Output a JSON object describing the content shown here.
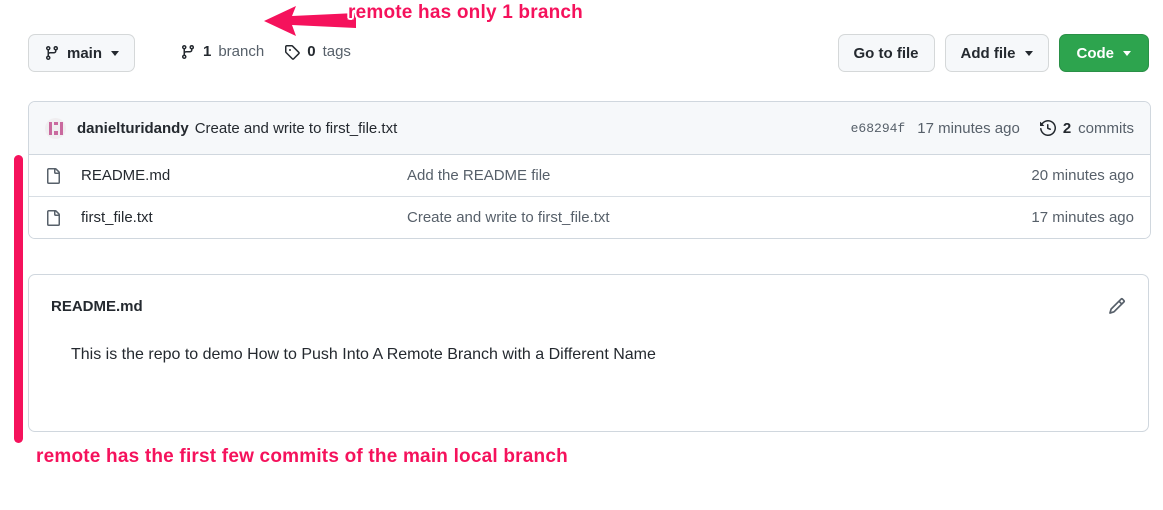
{
  "annotations": {
    "top_note": "remote has only 1 branch",
    "bottom_note": "remote has the first few commits of the main local branch",
    "accent_color": "#f5125c",
    "arrow_icon": "left-arrow-icon",
    "bar_icon": "vertical-highlight-bar"
  },
  "toolbar": {
    "branch_selector": {
      "label": "main",
      "icon": "git-branch-icon",
      "caret": "chevron-down-icon"
    },
    "refs": [
      {
        "count": "1",
        "label": "branch",
        "icon": "git-branch-icon"
      },
      {
        "count": "0",
        "label": "tags",
        "icon": "tag-icon"
      }
    ],
    "actions": {
      "go_to_file": "Go to file",
      "add_file": "Add file",
      "code": "Code",
      "code_color": "#2da44e"
    }
  },
  "commit_bar": {
    "avatar_icon": "user-avatar-identicon",
    "author": "danielturidandy",
    "message": "Create and write to first_file.txt",
    "sha": "e68294f",
    "relative_time": "17 minutes ago",
    "commits_count": "2",
    "commits_label": "commits",
    "history_icon": "history-clock-icon"
  },
  "files": [
    {
      "icon": "file-icon",
      "name": "README.md",
      "message": "Add the README file",
      "time": "20 minutes ago"
    },
    {
      "icon": "file-icon",
      "name": "first_file.txt",
      "message": "Create and write to first_file.txt",
      "time": "17 minutes ago"
    }
  ],
  "readme": {
    "title": "README.md",
    "edit_icon": "pencil-icon",
    "body": "This is the repo to demo How to Push Into A Remote Branch with a Different Name"
  }
}
